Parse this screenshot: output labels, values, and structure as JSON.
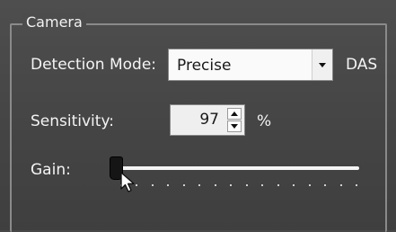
{
  "camera": {
    "group_title": "Camera",
    "detection_mode": {
      "label": "Detection Mode:",
      "selected": "Precise",
      "suffix": "DAS"
    },
    "sensitivity": {
      "label": "Sensitivity:",
      "value": "97",
      "unit": "%"
    },
    "gain": {
      "label": "Gain:",
      "level_fraction": 0,
      "tick_count": 16
    }
  },
  "icons": {
    "dropdown": "chevron-down-icon",
    "spin_up": "arrow-up-icon",
    "spin_down": "arrow-down-icon",
    "cursor": "mouse-pointer-icon"
  },
  "colors": {
    "background": "#474747",
    "text": "#f0f0f0",
    "track": "#f4f4f4",
    "thumb": "#151515"
  }
}
